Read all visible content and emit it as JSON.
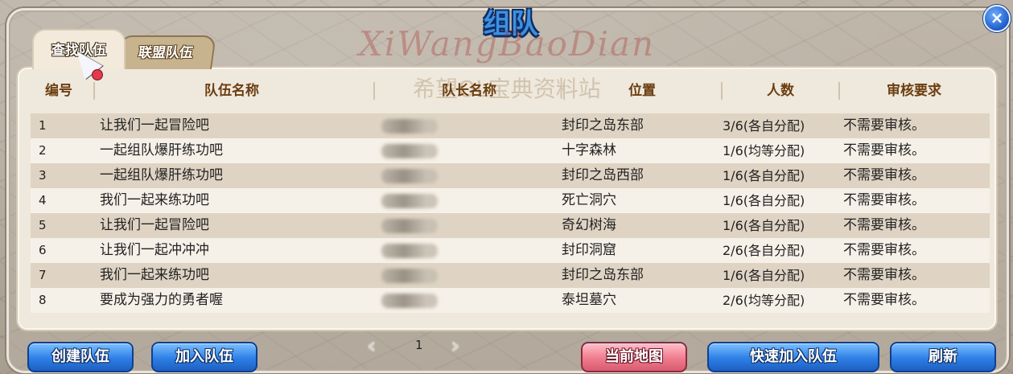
{
  "window": {
    "title": "组队",
    "close_label": "×"
  },
  "tabs": [
    {
      "label": "查找队伍",
      "active": true
    },
    {
      "label": "联盟队伍",
      "active": false
    }
  ],
  "watermark": {
    "line1": "XiWangBaoDian",
    "line2": "希望OL宝典资料站"
  },
  "table": {
    "headers": [
      "编号",
      "队伍名称",
      "队长名称",
      "位置",
      "人数",
      "审核要求"
    ],
    "rows": [
      {
        "num": "1",
        "name": "让我们一起冒险吧",
        "location": "封印之岛东部",
        "count": "3/6(各自分配)",
        "requirement": "不需要审核。"
      },
      {
        "num": "2",
        "name": "一起组队爆肝练功吧",
        "location": "十字森林",
        "count": "1/6(均等分配)",
        "requirement": "不需要审核。"
      },
      {
        "num": "3",
        "name": "一起组队爆肝练功吧",
        "location": "封印之岛西部",
        "count": "1/6(各自分配)",
        "requirement": "不需要审核。"
      },
      {
        "num": "4",
        "name": "我们一起来练功吧",
        "location": "死亡洞穴",
        "count": "1/6(各自分配)",
        "requirement": "不需要审核。"
      },
      {
        "num": "5",
        "name": "让我们一起冒险吧",
        "location": "奇幻树海",
        "count": "1/6(各自分配)",
        "requirement": "不需要审核。"
      },
      {
        "num": "6",
        "name": "让我们一起冲冲冲",
        "location": "封印洞窟",
        "count": "2/6(各自分配)",
        "requirement": "不需要审核。"
      },
      {
        "num": "7",
        "name": "我们一起来练功吧",
        "location": "封印之岛东部",
        "count": "1/6(各自分配)",
        "requirement": "不需要审核。"
      },
      {
        "num": "8",
        "name": "要成为强力的勇者喔",
        "location": "泰坦墓穴",
        "count": "2/6(均等分配)",
        "requirement": "不需要审核。"
      }
    ]
  },
  "pager": {
    "page": "1",
    "prev_icon": "‹",
    "next_icon": "›"
  },
  "buttons": {
    "create": "创建队伍",
    "join": "加入队伍",
    "current_map": "当前地图",
    "quick_join": "快速加入队伍",
    "refresh": "刷新"
  },
  "colors": {
    "accent_blue": "#2d7fe6",
    "pink_button": "#f07b8d",
    "header_text": "#6b3e10"
  }
}
